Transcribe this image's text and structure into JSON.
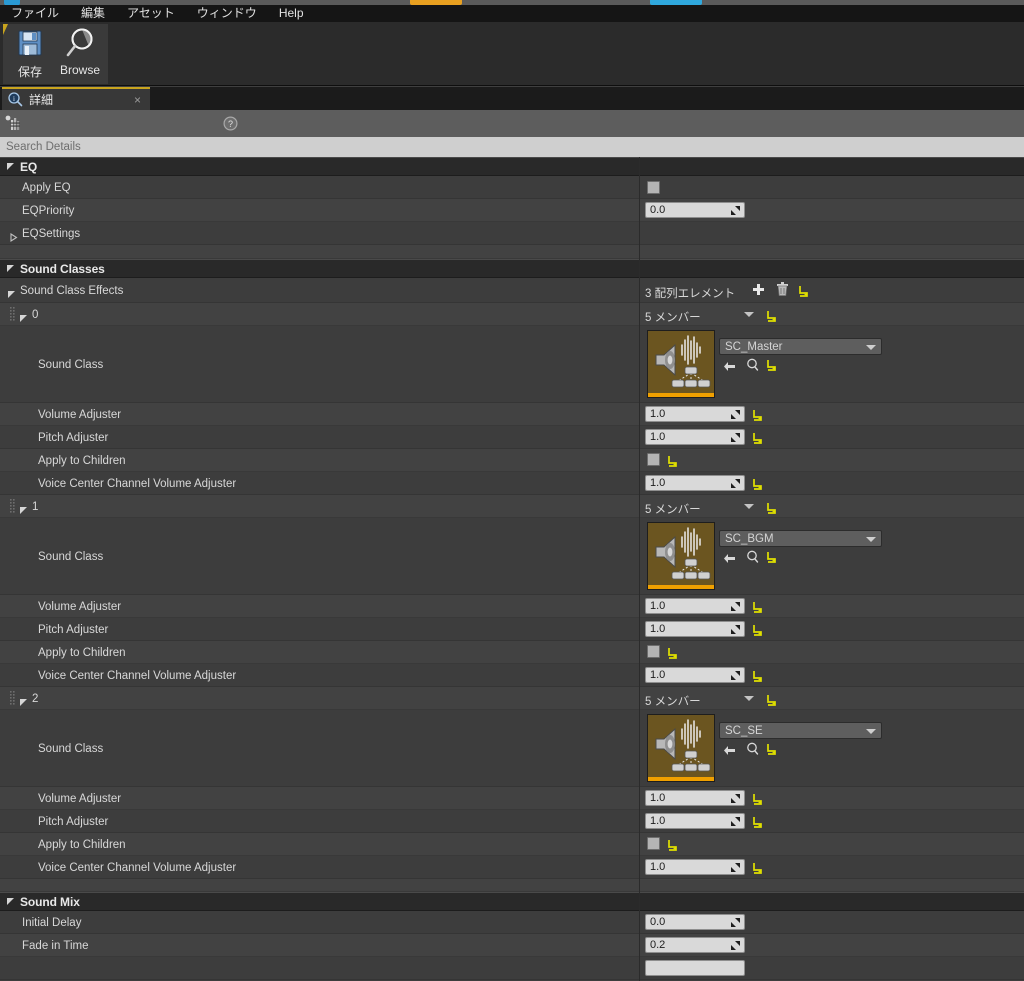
{
  "window": {
    "menu_items": [
      "ファイル",
      "編集",
      "アセット",
      "ウィンドウ",
      "Help"
    ]
  },
  "toolbar": {
    "save_label": "保存",
    "browse_label": "Browse"
  },
  "tab": {
    "title": "詳細",
    "close_label": "×"
  },
  "search": {
    "placeholder": "Search Details",
    "value": ""
  },
  "categories": [
    {
      "name": "EQ",
      "rows": [
        {
          "label": "Apply EQ",
          "type": "checkbox",
          "checked": false
        },
        {
          "label": "EQPriority",
          "type": "number",
          "value": "0.0"
        },
        {
          "label": "EQSettings",
          "type": "expandable"
        }
      ]
    },
    {
      "name": "Sound Classes"
    },
    {
      "name": "Sound Mix"
    }
  ],
  "sound_class_effects": {
    "label": "Sound Class Effects",
    "array_count_label": "3 配列エレメント",
    "add_icon": "plus-icon",
    "delete_icon": "trash-icon",
    "reset_icon": "reset-arrow-icon",
    "member_count_label": "5 メンバー",
    "elements": [
      {
        "index": "0",
        "sound_class_label": "Sound Class",
        "asset_name": "SC_Master",
        "properties": [
          {
            "label": "Volume Adjuster",
            "type": "number",
            "value": "1.0"
          },
          {
            "label": "Pitch Adjuster",
            "type": "number",
            "value": "1.0"
          },
          {
            "label": "Apply to Children",
            "type": "checkbox",
            "checked": false
          },
          {
            "label": "Voice Center Channel Volume Adjuster",
            "type": "number",
            "value": "1.0"
          }
        ]
      },
      {
        "index": "1",
        "sound_class_label": "Sound Class",
        "asset_name": "SC_BGM",
        "properties": [
          {
            "label": "Volume Adjuster",
            "type": "number",
            "value": "1.0"
          },
          {
            "label": "Pitch Adjuster",
            "type": "number",
            "value": "1.0"
          },
          {
            "label": "Apply to Children",
            "type": "checkbox",
            "checked": false
          },
          {
            "label": "Voice Center Channel Volume Adjuster",
            "type": "number",
            "value": "1.0"
          }
        ]
      },
      {
        "index": "2",
        "sound_class_label": "Sound Class",
        "asset_name": "SC_SE",
        "properties": [
          {
            "label": "Volume Adjuster",
            "type": "number",
            "value": "1.0"
          },
          {
            "label": "Pitch Adjuster",
            "type": "number",
            "value": "1.0"
          },
          {
            "label": "Apply to Children",
            "type": "checkbox",
            "checked": false
          },
          {
            "label": "Voice Center Channel Volume Adjuster",
            "type": "number",
            "value": "1.0"
          }
        ]
      }
    ]
  },
  "sound_mix": {
    "rows": [
      {
        "label": "Initial Delay",
        "type": "number",
        "value": "0.0"
      },
      {
        "label": "Fade in Time",
        "type": "number",
        "value": "0.2"
      }
    ]
  },
  "colors": {
    "accent_yellow": "#c8a41e",
    "reset_arrow": "#e0e000",
    "panel_bg": "#3d3d3d",
    "category_bg": "#292929",
    "field_bg": "#d9d9d9",
    "thumbnail_bg": "#6b5520",
    "thumbnail_bar": "#f0a000"
  }
}
